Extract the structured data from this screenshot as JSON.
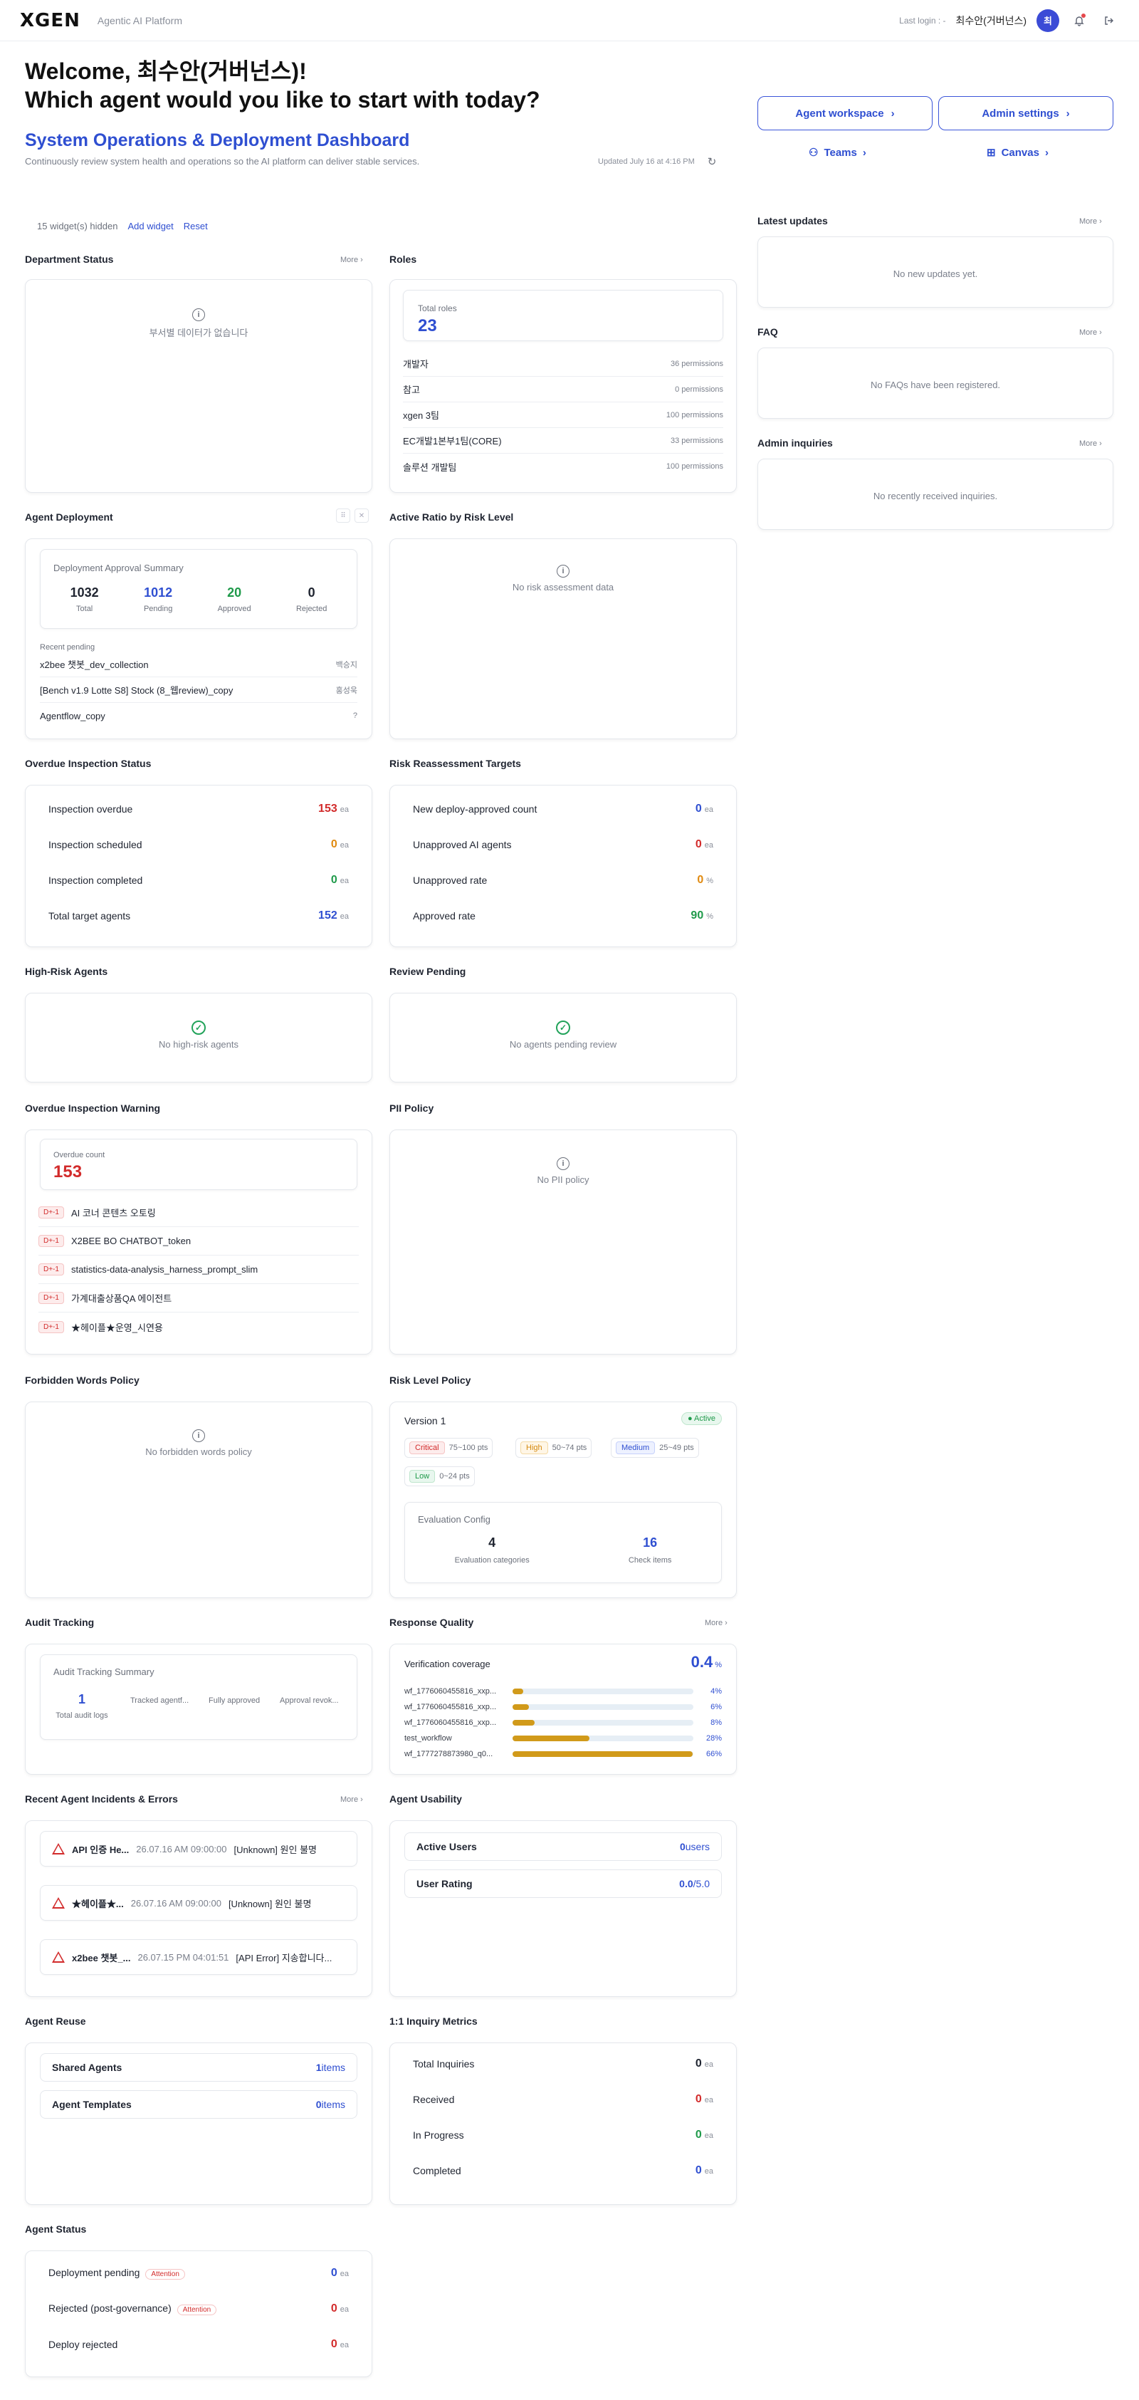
{
  "header": {
    "logo": "XGEN",
    "platform": "Agentic AI Platform",
    "last_login": "Last login : -",
    "user_name": "최수안(거버넌스)",
    "avatar_initial": "최"
  },
  "welcome": {
    "line1": "Welcome, 최수안(거버넌스)!",
    "line2": "Which agent would you like to start with today?"
  },
  "dashboard": {
    "title": "System Operations & Deployment Dashboard",
    "subtitle": "Continuously review system health and operations so the AI platform can deliver stable services.",
    "updated": "Updated July 16 at 4:16 PM"
  },
  "actions": {
    "agent_workspace": "Agent workspace",
    "admin_settings": "Admin settings",
    "teams": "Teams",
    "canvas": "Canvas"
  },
  "widgets": {
    "hidden": "15 widget(s) hidden",
    "add": "Add widget",
    "reset": "Reset"
  },
  "more": "More",
  "department_status": {
    "title": "Department Status",
    "empty": "부서별 데이터가 없습니다"
  },
  "roles": {
    "title": "Roles",
    "total_label": "Total roles",
    "total": "23",
    "items": [
      {
        "name": "개발자",
        "perm": "36 permissions"
      },
      {
        "name": "참고",
        "perm": "0 permissions"
      },
      {
        "name": "xgen 3팀",
        "perm": "100 permissions"
      },
      {
        "name": "EC개발1본부1팀(CORE)",
        "perm": "33 permissions"
      },
      {
        "name": "솔루션 개발팀",
        "perm": "100 permissions"
      }
    ]
  },
  "agent_deployment": {
    "title": "Agent Deployment",
    "summary_title": "Deployment Approval Summary",
    "stats": [
      {
        "value": "1032",
        "label": "Total"
      },
      {
        "value": "1012",
        "label": "Pending"
      },
      {
        "value": "20",
        "label": "Approved"
      },
      {
        "value": "0",
        "label": "Rejected"
      }
    ],
    "recent_label": "Recent pending",
    "recent": [
      {
        "name": "x2bee 챗봇_dev_collection",
        "who": "백승지"
      },
      {
        "name": "[Bench v1.9 Lotte S8] Stock (8_웹review)_copy",
        "who": "홍성욱"
      },
      {
        "name": "Agentflow_copy",
        "who": "?"
      }
    ]
  },
  "active_ratio": {
    "title": "Active Ratio by Risk Level",
    "empty": "No risk assessment data"
  },
  "overdue_inspection": {
    "title": "Overdue Inspection Status",
    "rows": [
      {
        "label": "Inspection overdue",
        "value": "153",
        "unit": "ea"
      },
      {
        "label": "Inspection scheduled",
        "value": "0",
        "unit": "ea"
      },
      {
        "label": "Inspection completed",
        "value": "0",
        "unit": "ea"
      },
      {
        "label": "Total target agents",
        "value": "152",
        "unit": "ea"
      }
    ]
  },
  "risk_reassessment": {
    "title": "Risk Reassessment Targets",
    "rows": [
      {
        "label": "New deploy-approved count",
        "value": "0",
        "unit": "ea"
      },
      {
        "label": "Unapproved AI agents",
        "value": "0",
        "unit": "ea"
      },
      {
        "label": "Unapproved rate",
        "value": "0",
        "unit": "%"
      },
      {
        "label": "Approved rate",
        "value": "90",
        "unit": "%"
      }
    ]
  },
  "high_risk": {
    "title": "High-Risk Agents",
    "empty": "No high-risk agents"
  },
  "review_pending": {
    "title": "Review Pending",
    "empty": "No agents pending review"
  },
  "overdue_warning": {
    "title": "Overdue Inspection Warning",
    "count_label": "Overdue count",
    "count": "153",
    "items": [
      {
        "badge": "D+-1",
        "name": "AI 코너 콘텐츠 오토링"
      },
      {
        "badge": "D+-1",
        "name": "X2BEE BO CHATBOT_token"
      },
      {
        "badge": "D+-1",
        "name": "statistics-data-analysis_harness_prompt_slim"
      },
      {
        "badge": "D+-1",
        "name": "가계대출상품QA 에이전트"
      },
      {
        "badge": "D+-1",
        "name": "★헤이플★운영_시연용"
      }
    ]
  },
  "pii_policy": {
    "title": "PII Policy",
    "empty": "No PII policy"
  },
  "forbidden_words": {
    "title": "Forbidden Words Policy",
    "empty": "No forbidden words policy"
  },
  "risk_level_policy": {
    "title": "Risk Level Policy",
    "version": "Version 1",
    "status": "Active",
    "levels": [
      {
        "name": "Critical",
        "range": "75~100 pts"
      },
      {
        "name": "High",
        "range": "50~74 pts"
      },
      {
        "name": "Medium",
        "range": "25~49 pts"
      },
      {
        "name": "Low",
        "range": "0~24 pts"
      }
    ],
    "eval_title": "Evaluation Config",
    "eval_categories": "4",
    "eval_categories_label": "Evaluation categories",
    "check_items": "16",
    "check_items_label": "Check items"
  },
  "audit_tracking": {
    "title": "Audit Tracking",
    "summary_title": "Audit Tracking Summary",
    "total": "1",
    "total_label": "Total audit logs",
    "col2": "Tracked agentf...",
    "col3": "Fully approved",
    "col4": "Approval revok..."
  },
  "response_quality": {
    "title": "Response Quality",
    "coverage_label": "Verification coverage",
    "coverage": "0.4",
    "coverage_unit": "%",
    "bars": [
      {
        "name": "wf_1776060455816_xxp...",
        "pct_text": "4%",
        "pct": 4
      },
      {
        "name": "wf_1776060455816_xxp...",
        "pct_text": "6%",
        "pct": 6
      },
      {
        "name": "wf_1776060455816_xxp...",
        "pct_text": "8%",
        "pct": 8
      },
      {
        "name": "test_workflow",
        "pct_text": "28%",
        "pct": 28
      },
      {
        "name": "wf_1777278873980_q0...",
        "pct_text": "66%",
        "pct": 66
      }
    ]
  },
  "incidents": {
    "title": "Recent Agent Incidents & Errors",
    "items": [
      {
        "name": "API 인증 He...",
        "time": "26.07.16 AM 09:00:00",
        "msg": "[Unknown] 원인 불명"
      },
      {
        "name": "★헤이플★...",
        "time": "26.07.16 AM 09:00:00",
        "msg": "[Unknown] 원인 불명"
      },
      {
        "name": "x2bee 챗봇_...",
        "time": "26.07.15 PM 04:01:51",
        "msg": "[API Error] 지송합니다..."
      }
    ]
  },
  "usability": {
    "title": "Agent Usability",
    "active_users_label": "Active Users",
    "active_users": "0",
    "active_users_unit": "users",
    "rating_label": "User Rating",
    "rating": "0.0",
    "rating_unit": "/5.0"
  },
  "reuse": {
    "title": "Agent Reuse",
    "shared_label": "Shared Agents",
    "shared": "1",
    "templates_label": "Agent Templates",
    "templates": "0",
    "unit": "items"
  },
  "inquiry_metrics": {
    "title": "1:1 Inquiry Metrics",
    "rows": [
      {
        "label": "Total Inquiries",
        "value": "0",
        "unit": "ea"
      },
      {
        "label": "Received",
        "value": "0",
        "unit": "ea"
      },
      {
        "label": "In Progress",
        "value": "0",
        "unit": "ea"
      },
      {
        "label": "Completed",
        "value": "0",
        "unit": "ea"
      }
    ]
  },
  "agent_status": {
    "title": "Agent Status",
    "attention": "Attention",
    "rows": [
      {
        "label": "Deployment pending",
        "value": "0",
        "unit": "ea"
      },
      {
        "label": "Rejected (post-governance)",
        "value": "0",
        "unit": "ea"
      },
      {
        "label": "Deploy rejected",
        "value": "0",
        "unit": "ea"
      }
    ]
  },
  "latest_updates": {
    "title": "Latest updates",
    "empty": "No new updates yet."
  },
  "faq": {
    "title": "FAQ",
    "empty": "No FAQs have been registered."
  },
  "admin_inquiries": {
    "title": "Admin inquiries",
    "empty": "No recently received inquiries."
  }
}
